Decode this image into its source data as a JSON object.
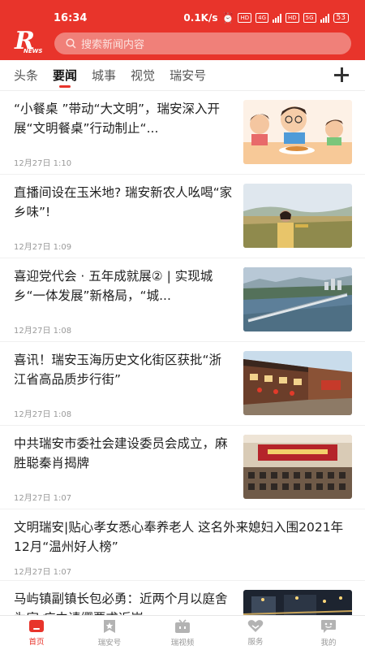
{
  "status": {
    "time": "16:34",
    "net": "0.1K/s",
    "signal_tags": [
      "HD",
      "4G",
      "HD",
      "5G"
    ],
    "battery": "53"
  },
  "header": {
    "logo_text": "R",
    "logo_sub": "NEWS",
    "search_placeholder": "搜索新闻内容"
  },
  "tabs": [
    {
      "label": "头条",
      "active": false
    },
    {
      "label": "要闻",
      "active": true
    },
    {
      "label": "城事",
      "active": false
    },
    {
      "label": "视觉",
      "active": false
    },
    {
      "label": "瑞安号",
      "active": false
    }
  ],
  "feed": [
    {
      "title": "“小餐桌 ”带动“大文明”，瑞安深入开展“文明餐桌”行动制止“...",
      "time": "12月27日 1:10",
      "image": "cartoon-family-dining"
    },
    {
      "title": "直播间设在玉米地? 瑞安新农人吆喝“家乡味”!",
      "time": "12月27日 1:09",
      "image": "woman-in-cornfield"
    },
    {
      "title": "喜迎党代会 · 五年成就展② | 实现城乡“一体发展”新格局，“城...",
      "time": "12月27日 1:08",
      "image": "river-bridge-aerial"
    },
    {
      "title": "喜讯！瑞安玉海历史文化街区获批“浙江省高品质步行街”",
      "time": "12月27日 1:08",
      "image": "historic-street"
    },
    {
      "title": "中共瑞安市委社会建设委员会成立，麻胜聪秦肖揭牌",
      "time": "12月27日 1:07",
      "image": "meeting-hall"
    },
    {
      "title": "文明瑞安|贴心孝女悉心奉养老人 这名外来媳妇入围2021年12月“温州好人榜”",
      "time": "12月27日 1:07",
      "image": ""
    },
    {
      "title": "马屿镇副镇长包必勇：近两个月以庭舍为家 病中请缨要求返岗",
      "time": "",
      "image": "night-scene"
    }
  ],
  "bottom_nav": [
    {
      "label": "首页",
      "icon": "home-icon",
      "active": true
    },
    {
      "label": "瑞安号",
      "icon": "bookmark-star-icon",
      "active": false
    },
    {
      "label": "瑞视频",
      "icon": "tv-icon",
      "active": false
    },
    {
      "label": "服务",
      "icon": "heart-hands-icon",
      "active": false
    },
    {
      "label": "我的",
      "icon": "chat-face-icon",
      "active": false
    }
  ],
  "colors": {
    "brand": "#e8342b",
    "text": "#222222",
    "meta": "#999999"
  }
}
